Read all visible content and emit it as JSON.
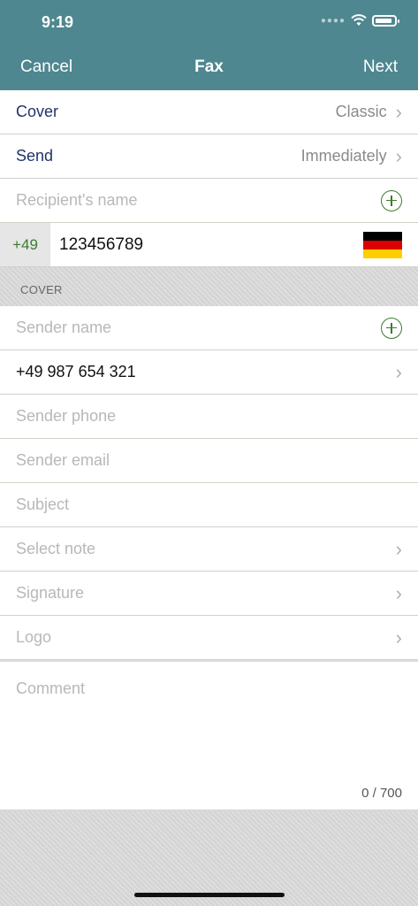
{
  "status": {
    "time": "9:19"
  },
  "nav": {
    "cancel": "Cancel",
    "title": "Fax",
    "next": "Next"
  },
  "rows": {
    "cover": {
      "label": "Cover",
      "value": "Classic"
    },
    "send": {
      "label": "Send",
      "value": "Immediately"
    },
    "recipient": {
      "placeholder": "Recipient's name"
    },
    "phone": {
      "country_code": "+49",
      "number": "123456789",
      "flag": [
        "#000000",
        "#dd0000",
        "#ffce00"
      ]
    }
  },
  "section": {
    "title": "COVER"
  },
  "cover_fields": {
    "sender_name": "Sender name",
    "sender_fax": "+49 987 654 321",
    "sender_phone": "Sender phone",
    "sender_email": "Sender email",
    "subject": "Subject",
    "select_note": "Select note",
    "signature": "Signature",
    "logo": "Logo"
  },
  "comment": {
    "placeholder": "Comment",
    "counter": "0 / 700"
  },
  "colors": {
    "header": "#4e8790",
    "accent_green": "#3a7d2c",
    "label_blue": "#22336b"
  }
}
